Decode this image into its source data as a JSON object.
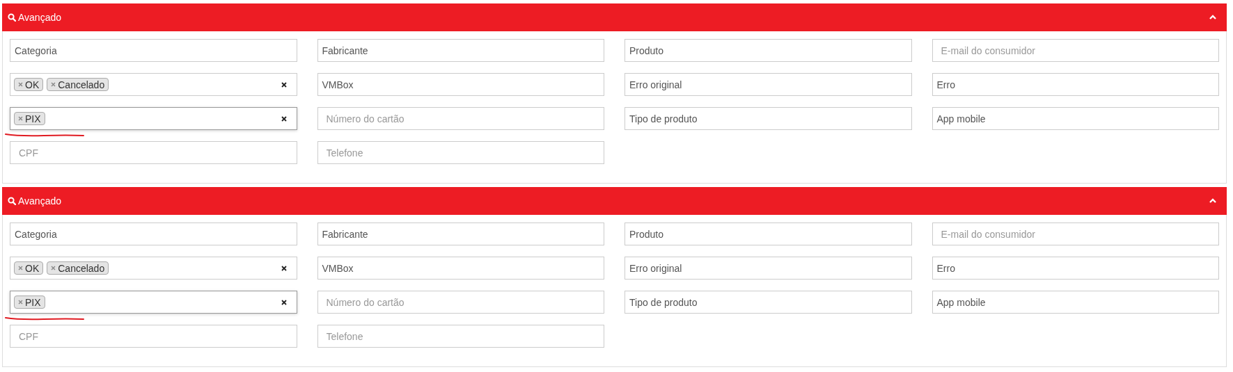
{
  "panels": [
    {
      "title": "Avançado",
      "expanded": true,
      "fields": [
        {
          "kind": "select",
          "placeholder": "Categoria",
          "focused": false,
          "underlined": false
        },
        {
          "kind": "select",
          "placeholder": "Fabricante",
          "focused": false,
          "underlined": false
        },
        {
          "kind": "select",
          "placeholder": "Produto",
          "focused": false,
          "underlined": false
        },
        {
          "kind": "input",
          "placeholder": "E-mail do consumidor",
          "focused": false,
          "underlined": false
        },
        {
          "kind": "tags",
          "tags": [
            "OK",
            "Cancelado"
          ],
          "focused": false,
          "underlined": false
        },
        {
          "kind": "select",
          "placeholder": "VMBox",
          "focused": false,
          "underlined": false
        },
        {
          "kind": "select",
          "placeholder": "Erro original",
          "focused": false,
          "underlined": false
        },
        {
          "kind": "select",
          "placeholder": "Erro",
          "focused": false,
          "underlined": false
        },
        {
          "kind": "tags",
          "tags": [
            "PIX"
          ],
          "focused": true,
          "underlined": true
        },
        {
          "kind": "input",
          "placeholder": "Número do cartão",
          "focused": false,
          "underlined": false
        },
        {
          "kind": "select",
          "placeholder": "Tipo de produto",
          "focused": false,
          "underlined": false
        },
        {
          "kind": "select",
          "placeholder": "App mobile",
          "focused": false,
          "underlined": false
        },
        {
          "kind": "input",
          "placeholder": "CPF",
          "focused": false,
          "underlined": false
        },
        {
          "kind": "input",
          "placeholder": "Telefone",
          "focused": false,
          "underlined": false
        }
      ]
    },
    {
      "title": "Avançado",
      "expanded": true,
      "fields": [
        {
          "kind": "select",
          "placeholder": "Categoria",
          "focused": false,
          "underlined": false
        },
        {
          "kind": "select",
          "placeholder": "Fabricante",
          "focused": false,
          "underlined": false
        },
        {
          "kind": "select",
          "placeholder": "Produto",
          "focused": false,
          "underlined": false
        },
        {
          "kind": "input",
          "placeholder": "E-mail do consumidor",
          "focused": false,
          "underlined": false
        },
        {
          "kind": "tags",
          "tags": [
            "OK",
            "Cancelado"
          ],
          "focused": false,
          "underlined": false
        },
        {
          "kind": "select",
          "placeholder": "VMBox",
          "focused": false,
          "underlined": false
        },
        {
          "kind": "select",
          "placeholder": "Erro original",
          "focused": false,
          "underlined": false
        },
        {
          "kind": "select",
          "placeholder": "Erro",
          "focused": false,
          "underlined": false
        },
        {
          "kind": "tags",
          "tags": [
            "PIX"
          ],
          "focused": true,
          "underlined": true
        },
        {
          "kind": "input",
          "placeholder": "Número do cartão",
          "focused": false,
          "underlined": false
        },
        {
          "kind": "select",
          "placeholder": "Tipo de produto",
          "focused": false,
          "underlined": false
        },
        {
          "kind": "select",
          "placeholder": "App mobile",
          "focused": false,
          "underlined": false
        },
        {
          "kind": "input",
          "placeholder": "CPF",
          "focused": false,
          "underlined": false
        },
        {
          "kind": "input",
          "placeholder": "Telefone",
          "focused": false,
          "underlined": false
        }
      ]
    }
  ]
}
